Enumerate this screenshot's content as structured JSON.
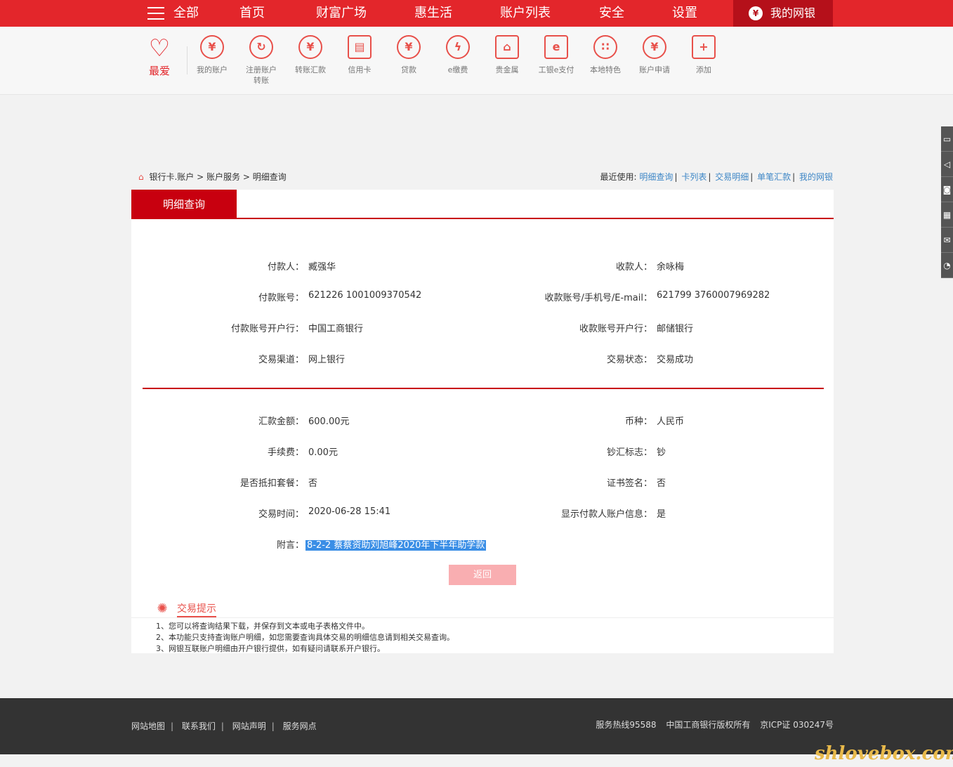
{
  "topnav": {
    "all": "全部",
    "items": [
      "首页",
      "财富广场",
      "惠生活",
      "账户列表",
      "安全",
      "设置"
    ],
    "mybank": "我的网银"
  },
  "quickbar": {
    "fav": "最爱",
    "items": [
      {
        "label": "我的账户",
        "icon": "yen-icon"
      },
      {
        "label": "注册账户转账",
        "icon": "refresh-icon"
      },
      {
        "label": "转账汇款",
        "icon": "transfer-yen-icon"
      },
      {
        "label": "信用卡",
        "icon": "credit-card-icon"
      },
      {
        "label": "贷款",
        "icon": "money-bag-icon"
      },
      {
        "label": "e缴费",
        "icon": "drop-icon"
      },
      {
        "label": "贵金属",
        "icon": "gold-bars-icon"
      },
      {
        "label": "工银e支付",
        "icon": "epay-icon"
      },
      {
        "label": "本地特色",
        "icon": "local-icon"
      },
      {
        "label": "账户申请",
        "icon": "apply-yen-icon"
      },
      {
        "label": "添加",
        "icon": "plus-icon"
      }
    ],
    "item2_line1": "注册账户",
    "item2_line2": "转账"
  },
  "breadcrumb": {
    "a": "银行卡.账户",
    "b": "账户服务",
    "c": "明细查询",
    "sep": ">"
  },
  "recent": {
    "label": "最近使用:",
    "links": [
      "明细查询",
      "卡列表",
      "交易明细",
      "单笔汇款",
      "我的网银"
    ]
  },
  "tab": "明细查询",
  "details": {
    "payer_label": "付款人：",
    "payer": "臧强华",
    "payee_label": "收款人：",
    "payee": "余咏梅",
    "payer_acct_label": "付款账号：",
    "payer_acct": "621226 1001009370542",
    "payee_acct_label": "收款账号/手机号/E-mail：",
    "payee_acct": "621799 3760007969282",
    "payer_bank_label": "付款账号开户行：",
    "payer_bank": "中国工商银行",
    "payee_bank_label": "收款账号开户行：",
    "payee_bank": "邮储银行",
    "channel_label": "交易渠道：",
    "channel": "网上银行",
    "status_label": "交易状态：",
    "status": "交易成功",
    "amount_label": "汇款金额：",
    "amount": "600.00元",
    "currency_label": "币种：",
    "currency": "人民币",
    "fee_label": "手续费：",
    "fee": "0.00元",
    "cash_label": "钞汇标志：",
    "cash": "钞",
    "package_label": "是否抵扣套餐：",
    "package": "否",
    "cert_label": "证书签名：",
    "cert": "否",
    "time_label": "交易时间：",
    "time": "2020-06-28 15:41",
    "show_label": "显示付款人账户信息：",
    "show": "是",
    "memo_label": "附言：",
    "memo": "8-2-2 蔡蔡资助刘旭峰2020年下半年助学款"
  },
  "back_button": "返回",
  "tips": {
    "title": "交易提示",
    "lines": [
      "1、您可以将查询结果下载，并保存到文本或电子表格文件中。",
      "2、本功能只支持查询账户明细，如您需要查询具体交易的明细信息请到相关交易查询。",
      "3、网银互联账户明细由开户银行提供，如有疑问请联系开户银行。"
    ]
  },
  "footer": {
    "links": [
      "网站地图",
      "联系我们",
      "网站声明",
      "服务网点"
    ],
    "hotline": "服务热线95588",
    "copyright": "中国工商银行版权所有",
    "icp": "京ICP证 030247号"
  },
  "watermark": "shlovebox.com",
  "colors": {
    "brand_red": "#e3262b",
    "dark_red": "#c8000f",
    "link_blue": "#3d86c6"
  }
}
